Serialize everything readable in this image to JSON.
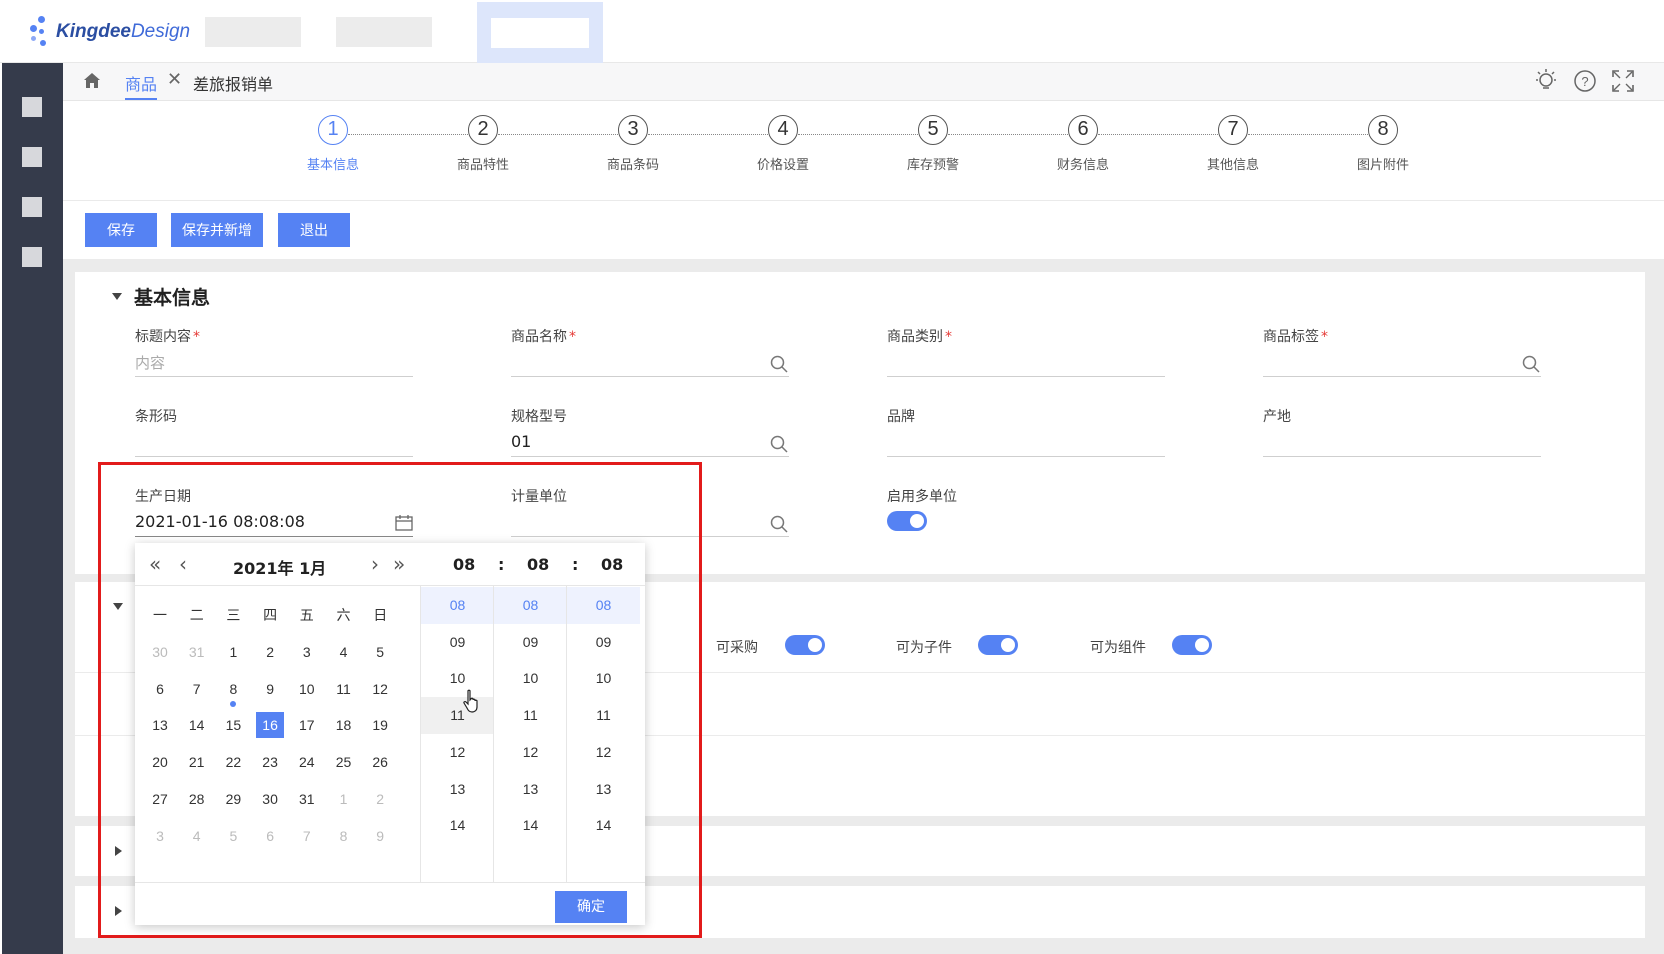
{
  "brand": {
    "name_bold": "Kingdee",
    "name_light": "Design"
  },
  "breadcrumb": {
    "active": "商品",
    "close_symbol": "✕",
    "second": "差旅报销单"
  },
  "steps": [
    {
      "num": "1",
      "label": "基本信息"
    },
    {
      "num": "2",
      "label": "商品特性"
    },
    {
      "num": "3",
      "label": "商品条码"
    },
    {
      "num": "4",
      "label": "价格设置"
    },
    {
      "num": "5",
      "label": "库存预警"
    },
    {
      "num": "6",
      "label": "财务信息"
    },
    {
      "num": "7",
      "label": "其他信息"
    },
    {
      "num": "8",
      "label": "图片附件"
    }
  ],
  "toolbar": {
    "save": "保存",
    "save_new": "保存并新增",
    "exit": "退出"
  },
  "section": {
    "title": "基本信息"
  },
  "fields": {
    "title_content": {
      "label": "标题内容",
      "placeholder": "内容"
    },
    "product_name": {
      "label": "商品名称"
    },
    "product_category": {
      "label": "商品类别"
    },
    "product_tag": {
      "label": "商品标签"
    },
    "barcode": {
      "label": "条形码"
    },
    "spec_model": {
      "label": "规格型号",
      "value": "01"
    },
    "brand": {
      "label": "品牌"
    },
    "origin": {
      "label": "产地"
    },
    "production_date": {
      "label": "生产日期",
      "value": "2021-01-16 08:08:08"
    },
    "unit": {
      "label": "计量单位"
    },
    "multi_unit": {
      "label": "启用多单位",
      "on": true
    },
    "required_mark": "*"
  },
  "toggles": [
    {
      "label": "可采购",
      "on": true
    },
    {
      "label": "可为子件",
      "on": true
    },
    {
      "label": "可为组件",
      "on": true
    }
  ],
  "picker": {
    "year_month": "2021年  1月",
    "hour": "08",
    "minute": "08",
    "second": "08",
    "colon": ":",
    "weekdays": [
      "一",
      "二",
      "三",
      "四",
      "五",
      "六",
      "日"
    ],
    "weeks": [
      [
        "30",
        "31",
        "1",
        "2",
        "3",
        "4",
        "5"
      ],
      [
        "6",
        "7",
        "8",
        "9",
        "10",
        "11",
        "12"
      ],
      [
        "13",
        "14",
        "15",
        "16",
        "17",
        "18",
        "19"
      ],
      [
        "20",
        "21",
        "22",
        "23",
        "24",
        "25",
        "26"
      ],
      [
        "27",
        "28",
        "29",
        "30",
        "31",
        "1",
        "2"
      ],
      [
        "3",
        "4",
        "5",
        "6",
        "7",
        "8",
        "9"
      ]
    ],
    "selected_day": "16",
    "today_day": "8",
    "time_options": [
      "08",
      "09",
      "10",
      "11",
      "12",
      "13",
      "14"
    ],
    "ok": "确定"
  },
  "colors": {
    "accent": "#5582f3",
    "nav": "#353b4b",
    "highlight": "#e21b1b"
  },
  "icons": [
    "home-icon",
    "close-icon",
    "bulb-icon",
    "help-icon",
    "fullscreen-icon",
    "search-icon",
    "calendar-icon",
    "double-left-icon",
    "left-icon",
    "right-icon",
    "double-right-icon",
    "cursor-hand-icon",
    "caret-down-icon",
    "caret-right-icon"
  ]
}
